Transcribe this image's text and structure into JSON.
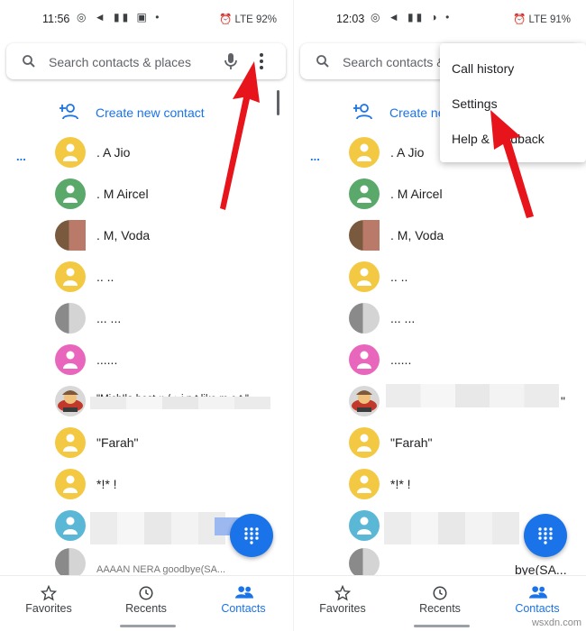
{
  "left": {
    "status_time": "11:56",
    "status_right": "LTE 92%",
    "search_placeholder": "Search contacts & places",
    "create_label": "Create new contact",
    "dots": "...",
    "contacts": [
      ". A Jio",
      ". M Aircel",
      ". M, Voda",
      ".. ..",
      "... ...",
      "......",
      "\"Mich!la bost ♥ / ♪ i n t like m e t \"",
      "\"Farah\"",
      "*!* !",
      "",
      "AAAAN NERA goodbye(SA..."
    ],
    "nav": {
      "favorites": "Favorites",
      "recents": "Recents",
      "contacts": "Contacts"
    }
  },
  "right": {
    "status_time": "12:03",
    "status_right": "LTE 91%",
    "search_placeholder": "Search contacts & places",
    "create_label": "Create new contact",
    "dots": "...",
    "contacts": [
      ". A Jio",
      ". M Aircel",
      ". M, Voda",
      ".. ..",
      "... ...",
      "......",
      "\"",
      "\"Farah\"",
      "*!* !",
      "",
      "bye(SA..."
    ],
    "menu": [
      "Call history",
      "Settings",
      "Help & feedback"
    ],
    "nav": {
      "favorites": "Favorites",
      "recents": "Recents",
      "contacts": "Contacts"
    }
  },
  "watermark": "wsxdn.com",
  "colors": {
    "accent": "#1a73e8",
    "arrow": "#e8141b"
  },
  "icons": [
    "search-icon",
    "mic-icon",
    "more-vert-icon",
    "add-person-icon",
    "person-icon",
    "dialpad-icon",
    "star-icon",
    "clock-icon",
    "people-icon"
  ]
}
